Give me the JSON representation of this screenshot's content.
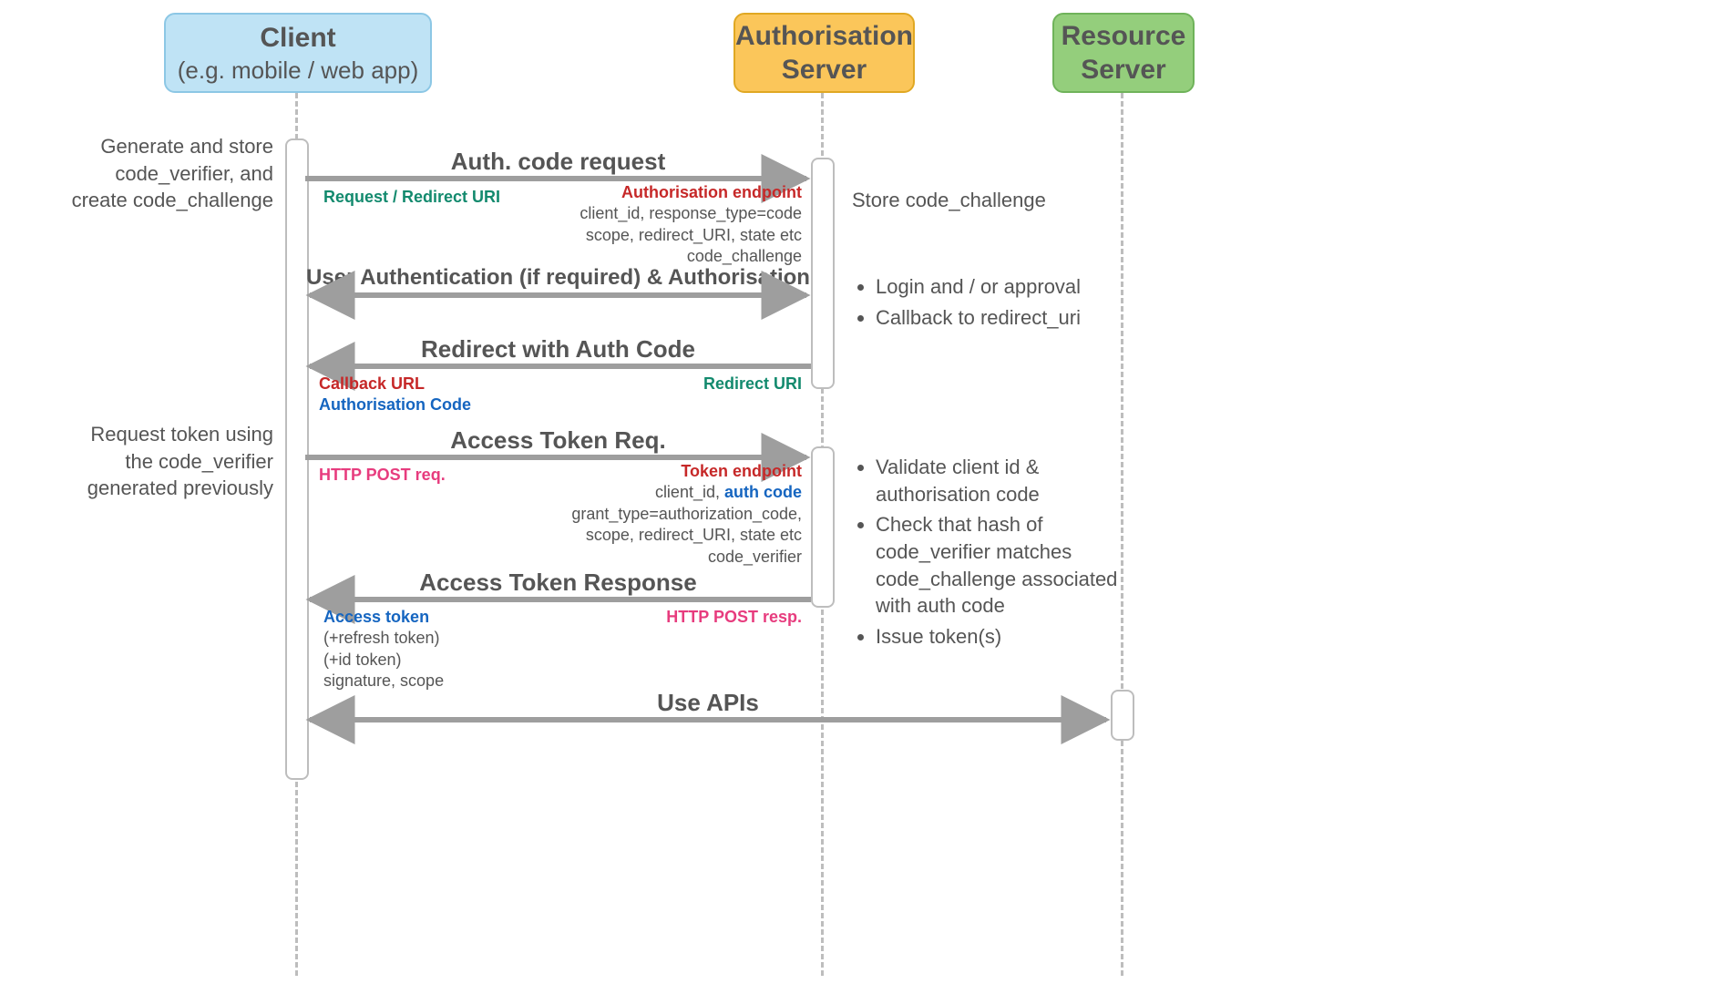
{
  "participants": {
    "client": {
      "title": "Client",
      "subtitle": "(e.g. mobile / web app)"
    },
    "auth": {
      "title": "Authorisation",
      "subtitle": "Server"
    },
    "res": {
      "title": "Resource",
      "subtitle": "Server"
    }
  },
  "leftNotes": {
    "generate": "Generate and store code_verifier, and create code_challenge",
    "requestToken": "Request token using the code_verifier generated previously"
  },
  "messages": {
    "m1": "Auth. code request",
    "m2": "User Authentication (if required) & Authorisation",
    "m3": "Redirect with Auth Code",
    "m4": "Access Token Req.",
    "m5": "Access Token Response",
    "m6": "Use APIs"
  },
  "annotations": {
    "m1_left": "Request / Redirect URI",
    "m1_right_title": "Authorisation endpoint",
    "m1_right_l1": "client_id, response_type=code",
    "m1_right_l2": "scope, redirect_URI, state etc",
    "m1_right_l3": "code_challenge",
    "m1_sideR": "Store code_challenge",
    "m2_sideR_1": "Login and / or approval",
    "m2_sideR_2": "Callback to redirect_uri",
    "m3_left_1": "Callback URL",
    "m3_left_2": "Authorisation Code",
    "m3_right": "Redirect URI",
    "m4_left": "HTTP POST req.",
    "m4_right_title": "Token endpoint",
    "m4_right_l1a": "client_id, ",
    "m4_right_l1b": "auth code",
    "m4_right_l2": "grant_type=authorization_code,",
    "m4_right_l3": "scope, redirect_URI, state etc",
    "m4_right_l4": "code_verifier",
    "m4_sideR_1": "Validate client id & authorisation code",
    "m4_sideR_2": "Check that hash of code_verifier matches code_challenge associated with auth code",
    "m4_sideR_3": "Issue token(s)",
    "m5_left_1": "Access token",
    "m5_left_2": "(+refresh token)",
    "m5_left_3": "(+id token)",
    "m5_left_4": "signature, scope",
    "m5_right": "HTTP POST resp."
  },
  "colors": {
    "client": "#bfe3f5",
    "clientBorder": "#8cc7e5",
    "auth": "#fbc65a",
    "authBorder": "#e0a823",
    "res": "#94ce7c",
    "resBorder": "#6fb35a",
    "arrow": "#9e9e9e"
  }
}
